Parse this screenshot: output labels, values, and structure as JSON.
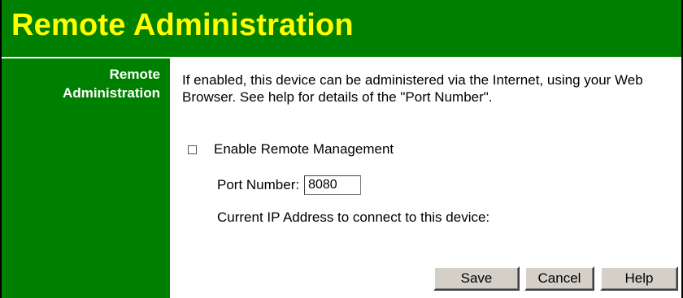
{
  "header": {
    "title": "Remote Administration"
  },
  "sidebar": {
    "label_line1": "Remote",
    "label_line2": "Administration"
  },
  "main": {
    "description": "If enabled, this device can be administered via the Internet, using your Web Browser. See help for details of the \"Port Number\".",
    "enable_checkbox": {
      "label": "Enable Remote Management",
      "checked": false
    },
    "port": {
      "label": "Port Number:",
      "value": "8080"
    },
    "current_ip_label": "Current IP Address to connect to this device:"
  },
  "buttons": {
    "save": "Save",
    "cancel": "Cancel",
    "help": "Help"
  },
  "colors": {
    "header_bg": "#008000",
    "title": "#ffff00",
    "sidebar_text": "#ffffff"
  }
}
